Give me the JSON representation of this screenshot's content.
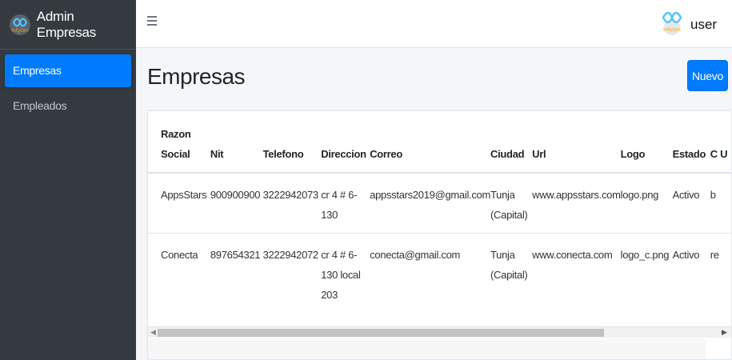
{
  "brand": {
    "title": "Admin Empresas",
    "logo_icon": "infinity-logo-icon"
  },
  "sidebar": {
    "items": [
      {
        "label": "Empresas",
        "active": true
      },
      {
        "label": "Empleados",
        "active": false
      }
    ]
  },
  "topbar": {
    "menu_icon": "hamburger-icon",
    "user_label": "user",
    "user_icon": "infinity-logo-icon"
  },
  "page": {
    "title": "Empresas",
    "new_button": "Nuevo"
  },
  "table": {
    "headers": [
      "Razon Social",
      "Nit",
      "Telefono",
      "Direccion",
      "Correo",
      "Ciudad",
      "Url",
      "Logo",
      "Estado",
      "C U"
    ],
    "rows": [
      [
        "AppsStars",
        "900900900",
        "3222942073",
        "cr 4 # 6-130",
        "appsstars2019@gmail.com",
        "Tunja (Capital)",
        "www.appsstars.com",
        "logo.png",
        "Activo",
        "b"
      ],
      [
        "Conecta",
        "897654321",
        "3222942072",
        "cr 4 # 6-130 local 203",
        "conecta@gmail.com",
        "Tunja (Capital)",
        "www.conecta.com",
        "logo_c.png",
        "Activo",
        "re"
      ]
    ]
  },
  "colors": {
    "sidebar_bg": "#343a40",
    "accent": "#007bff",
    "content_bg": "#f4f6f9"
  }
}
